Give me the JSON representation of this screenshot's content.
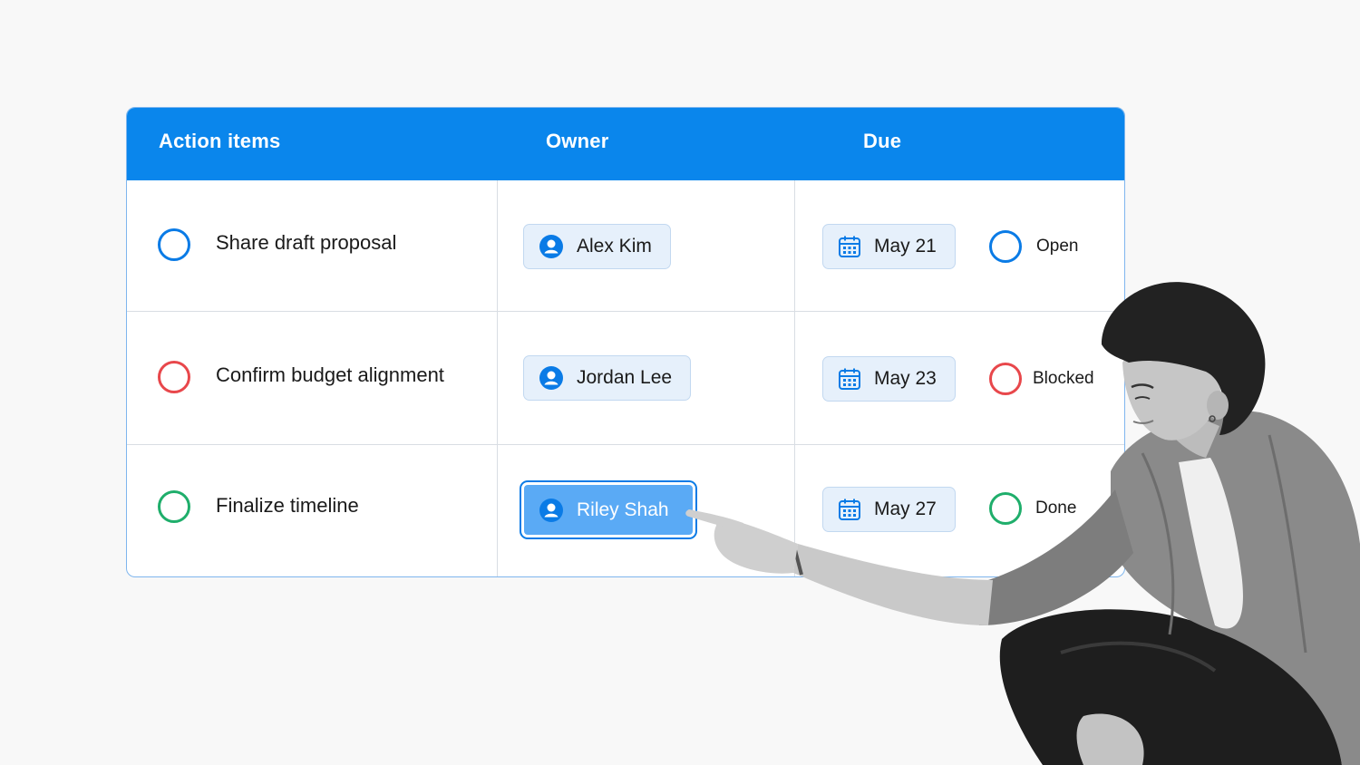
{
  "header": {
    "col_action": "Action items",
    "col_owner": "Owner",
    "col_due": "Due"
  },
  "rows": [
    {
      "task": "Share draft proposal",
      "owner": "Alex Kim",
      "due": "May 21",
      "status": "Open",
      "color": "#0a7be6"
    },
    {
      "task": "Confirm budget alignment",
      "owner": "Jordan Lee",
      "due": "May 23",
      "status": "Blocked",
      "color": "#e8474b"
    },
    {
      "task": "Finalize timeline",
      "owner": "Riley Shah",
      "due": "May 27",
      "status": "Done",
      "color": "#1fae6b",
      "owner_selected": true
    }
  ],
  "icons": {
    "owner": "user-icon",
    "due": "calendar-icon"
  },
  "colors": {
    "header": "#0a86ec",
    "accent": "#0a7be6",
    "blocked": "#e8474b",
    "done": "#1fae6b"
  }
}
